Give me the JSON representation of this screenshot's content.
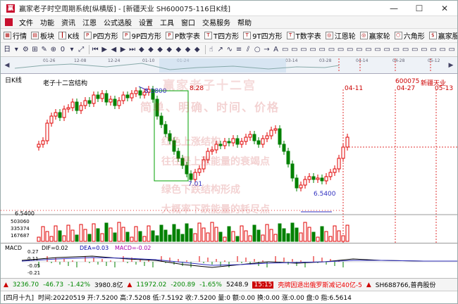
{
  "window": {
    "title": "赢家老子时空周期系统[纵横版] - [新疆天业  SH600075-116日K线]",
    "controls": [
      "—",
      "☐",
      "✕"
    ]
  },
  "menubar": {
    "items": [
      "文件",
      "功能",
      "资讯",
      "江恩",
      "公式选股",
      "设置",
      "工具",
      "窗口",
      "交易服务",
      "帮助"
    ]
  },
  "toolbar1": {
    "items": [
      {
        "icon": "grid-icon",
        "label": "行情"
      },
      {
        "icon": "blocks-icon",
        "label": "板块"
      },
      {
        "icon": "candle-icon",
        "label": "K线"
      },
      {
        "icon": "p-icon",
        "label": "P四方形"
      },
      {
        "icon": "p-icon",
        "label": "9P四方形"
      },
      {
        "icon": "p-icon",
        "label": "P数字表"
      },
      {
        "icon": "t-icon",
        "label": "T四方形"
      },
      {
        "icon": "t-icon",
        "label": "9T四方形"
      },
      {
        "icon": "t-icon",
        "label": "T数字表"
      },
      {
        "icon": "wheel-icon",
        "label": "江恩轮"
      },
      {
        "icon": "wheel-icon",
        "label": "赢家轮"
      },
      {
        "icon": "hexagon-icon",
        "label": "六角形"
      },
      {
        "icon": "service-icon",
        "label": "赢家服务"
      }
    ]
  },
  "toolbar2": {
    "period_label": "日",
    "zero_label": "0"
  },
  "time_axis": {
    "dates": [
      "01-26",
      "12-08",
      "12-24",
      "01-10",
      "01-24",
      "03-14",
      "03-28",
      "04-14",
      "04-28",
      "05-12"
    ]
  },
  "chart": {
    "period_label": "日K线",
    "indicator_name": "老子十二宫结构",
    "code_label": "600075",
    "stock_name": "新疆天业",
    "high_price_label": "8.3800",
    "high_date_label": "8.28",
    "low_price_label": "6.5400",
    "mid_price_label": "7.01",
    "future_dates": [
      "04-11",
      "04-27",
      "05-13"
    ],
    "price_axis_label": "6.5400",
    "volume_labels": [
      "503060",
      "335374",
      "167687"
    ],
    "watermark_lines": [
      "赢家老子十二宫",
      "简单、明确、时间、价格",
      "红色上涨结构",
      "往往是上涨能量的衰竭点",
      "绿色下跌结构形成",
      "大概率下跌能量的耗尽点"
    ]
  },
  "macd": {
    "title": "MACD",
    "dif": "DIF=0.02",
    "dea": "DEA=0.03",
    "macd": "MACD=-0.02",
    "scale": [
      "0.27",
      "0.11",
      "-0.05",
      "-0.21"
    ]
  },
  "status": {
    "sh_index": "3236.70",
    "sh_change": "-46.73",
    "sh_pct": "-1.42%",
    "sh_amount": "3980.8亿",
    "sz_index": "11972.02",
    "sz_change": "-200.89",
    "sz_pct": "-1.65%",
    "sz_amount": "5248.9",
    "time": "15:15",
    "news": "壳牌因退出俄罗斯减记40亿-5",
    "ticker": "SH688766,普冉股份"
  },
  "statusbar2": {
    "period": "[四月十九]",
    "detail": "时间:20220519 开:7.5200 高:7.5208 低:7.5192 收:7.5200 量:0 额:0.00 换:0.00 涨:0.00 盘:0 指:6.5614"
  },
  "colors": {
    "up": "#e00000",
    "down": "#008000",
    "box": "#00a000",
    "guide_red": "#e03030",
    "guide_blue": "#3030c0",
    "watermark": "#c83030"
  }
}
